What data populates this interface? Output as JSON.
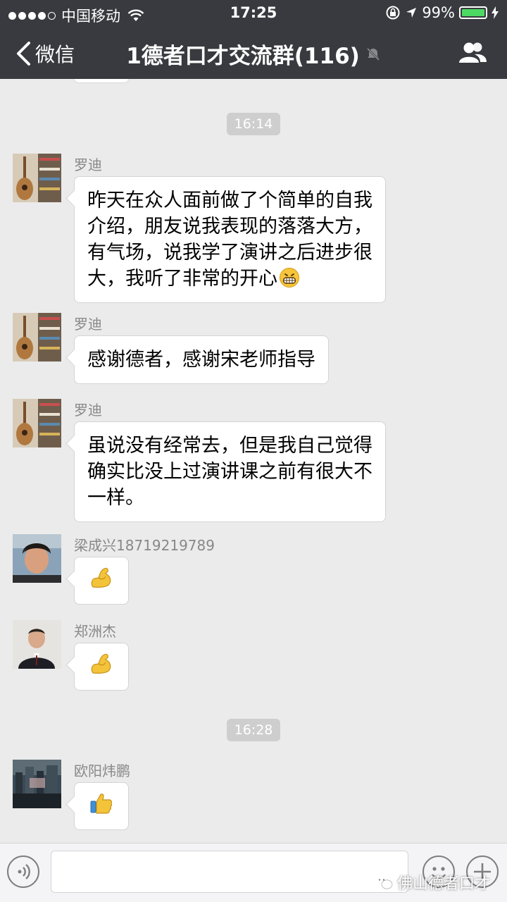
{
  "status_bar": {
    "carrier": "中国移动",
    "time": "17:25",
    "battery": "99%",
    "battery_level": 0.99
  },
  "nav": {
    "back_label": "微信",
    "title": "1德者口才交流群(116)",
    "icons": [
      "chevron-left-icon",
      "mute-bell-icon",
      "group-members-icon"
    ]
  },
  "timestamps": [
    "16:14",
    "16:28"
  ],
  "messages": [
    {
      "sender": "罗迪",
      "lines": [
        "昨天在众人面前做了个简单的自我",
        "介绍，朋友说我表现的落落大方，",
        "有气场，说我学了演讲之后进步很",
        "大，我听了非常的开心"
      ],
      "trailing_emoji": "grinning-face-icon"
    },
    {
      "sender": "罗迪",
      "lines": [
        "感谢德者，感谢宋老师指导"
      ]
    },
    {
      "sender": "罗迪",
      "lines": [
        "虽说没有经常去，但是我自己觉得",
        "确实比没上过演讲课之前有很大不",
        "一样。"
      ]
    },
    {
      "sender": "梁成兴18719219789",
      "emoji": "flexed-biceps-icon"
    },
    {
      "sender": "郑洲杰",
      "emoji": "flexed-biceps-icon"
    },
    {
      "sender": "欧阳炜鹏",
      "emoji": "thumbs-up-icon"
    }
  ],
  "input_bar": {
    "icons": [
      "voice-icon",
      "emoji-icon",
      "plus-icon"
    ]
  },
  "watermark": "佛山德者口才",
  "colors": {
    "nav_bg": "#393a3f",
    "chat_bg": "#ebebeb",
    "bubble_bg": "#ffffff",
    "timestamp_bg": "#cecece",
    "battery_green": "#4cd964"
  }
}
